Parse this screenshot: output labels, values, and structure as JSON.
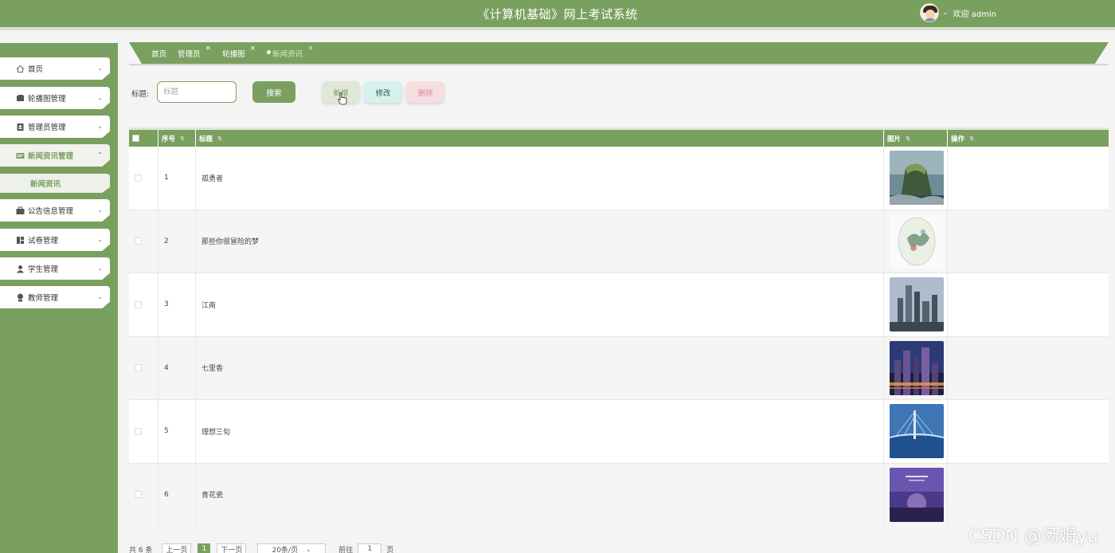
{
  "app": {
    "title": "《计算机基础》网上考试系统",
    "welcome": "欢迎 admin"
  },
  "sidebar": {
    "items": [
      {
        "label": "首页",
        "icon": "home-icon"
      },
      {
        "label": "轮播图管理",
        "icon": "image-icon"
      },
      {
        "label": "管理员管理",
        "icon": "badge-icon"
      },
      {
        "label": "新闻资讯管理",
        "icon": "news-icon",
        "active": true
      },
      {
        "label": "公告信息管理",
        "icon": "briefcase-icon"
      },
      {
        "label": "试卷管理",
        "icon": "grid-icon"
      },
      {
        "label": "学生管理",
        "icon": "user-icon"
      },
      {
        "label": "教师管理",
        "icon": "teacher-icon"
      }
    ],
    "sub_item": "新闻资讯"
  },
  "breadcrumb": {
    "items": [
      {
        "label": "首页",
        "closable": false
      },
      {
        "label": "管理员",
        "closable": true
      },
      {
        "label": "轮播图",
        "closable": true
      },
      {
        "label": "新闻资讯",
        "closable": true,
        "current": true
      }
    ],
    "close_glyph": "×"
  },
  "search": {
    "label": "标题:",
    "placeholder": "标题",
    "button": "搜索"
  },
  "actions": {
    "add": "新增",
    "edit": "修改",
    "delete": "删除"
  },
  "table": {
    "headers": [
      "序号",
      "标题",
      "图片",
      "操作"
    ],
    "rows": [
      {
        "index": "1",
        "title": "孤勇者",
        "image": "island-photo"
      },
      {
        "index": "2",
        "title": "那些你很冒险的梦",
        "image": "porcelain-plate-photo"
      },
      {
        "index": "3",
        "title": "江南",
        "image": "city-skyline-photo"
      },
      {
        "index": "4",
        "title": "七里香",
        "image": "night-city-photo"
      },
      {
        "index": "5",
        "title": "理想三旬",
        "image": "bridge-night-photo"
      },
      {
        "index": "6",
        "title": "青花瓷",
        "image": "purple-poster-photo"
      }
    ]
  },
  "pagination": {
    "total": "共 6 条",
    "prev": "上一页",
    "current_page": "1",
    "next": "下一页",
    "page_size": "20条/页",
    "goto_label": "前往",
    "goto_value": "1",
    "page_unit": "页"
  },
  "watermark": "CSDN @汤姆yu",
  "colors": {
    "accent": "#7aa05f",
    "header": "#7aa05f",
    "delete": "#e08b96"
  }
}
